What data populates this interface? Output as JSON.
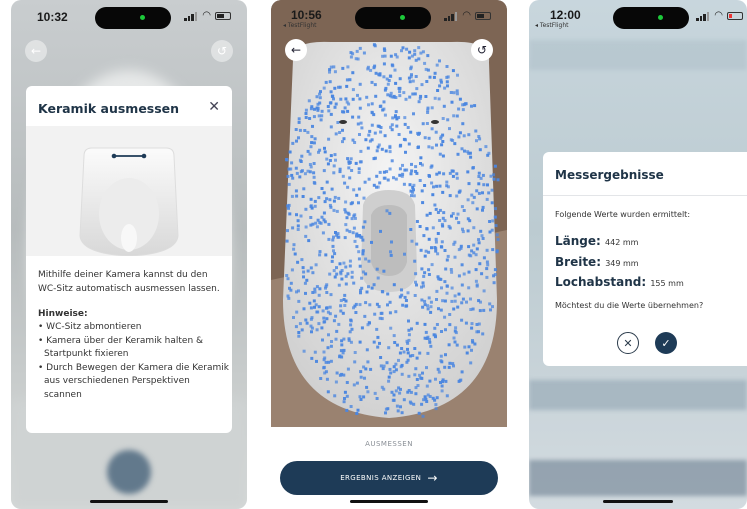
{
  "screen1": {
    "time": "10:32",
    "card": {
      "title": "Keramik ausmessen",
      "close_icon": "close-icon",
      "description": "Mithilfe deiner Kamera kannst du den WC-Sitz automatisch ausmessen lassen.",
      "hints_title": "Hinweise:",
      "hints": [
        "• WC-Sitz abmontieren",
        "• Kamera über der Keramik halten & Startpunkt fixieren",
        "• Durch Bewegen der Kamera die Keramik aus verschiedenen Perspektiven scannen"
      ]
    }
  },
  "screen2": {
    "time": "10:56",
    "app_source": "◂ TestFlight",
    "back_icon": "back-arrow-icon",
    "undo_icon": "undo-icon",
    "measure_label": "AUSMESSEN",
    "result_button_label": "ERGEBNIS ANZEIGEN",
    "result_button_icon": "arrow-right-icon"
  },
  "screen3": {
    "time": "12:00",
    "app_source": "◂ TestFlight",
    "card": {
      "title": "Messergebnisse",
      "intro": "Folgende Werte wurden ermittelt:",
      "length_label": "Länge:",
      "length_value": "442 mm",
      "width_label": "Breite:",
      "width_value": "349 mm",
      "hole_label": "Lochabstand:",
      "hole_value": "155 mm",
      "question": "Möchtest du die Werte übernehmen?",
      "cancel_icon": "close-icon",
      "confirm_icon": "check-icon"
    }
  },
  "colors": {
    "primary": "#1e3b57",
    "scan_dots": "#4a86e0"
  }
}
